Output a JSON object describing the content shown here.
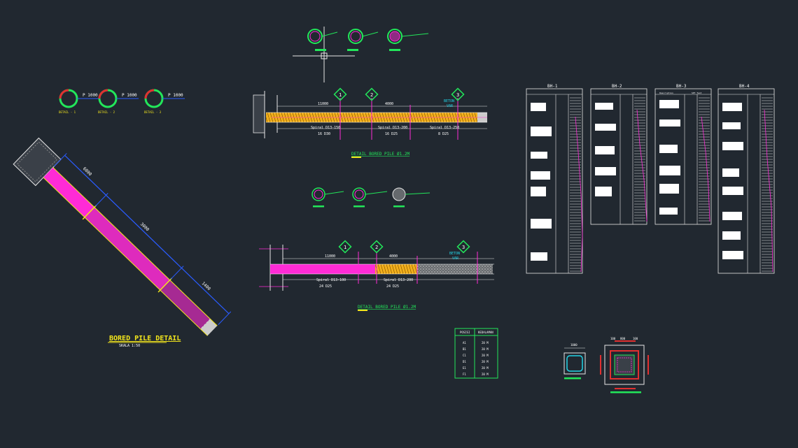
{
  "colors": {
    "background": "#212830",
    "line": "#e6e6e6",
    "dim": "#2a5cff",
    "magenta": "#ff2bd6",
    "yellow": "#f2e51c",
    "green": "#22e65a",
    "cyan": "#22d3e6",
    "red": "#e03030",
    "text_yellow": "#f2e51c",
    "log_fill": "#ffffff"
  },
  "left_detail": {
    "title": "BORED PILE DETAIL",
    "scale": "SKALA  1:50",
    "dims": [
      "6000",
      "3000",
      "1400"
    ]
  },
  "top_left_sections": [
    {
      "label": "P 1000",
      "tag": "DETAIL - 1"
    },
    {
      "label": "P 1000",
      "tag": "DETAIL - 2"
    },
    {
      "label": "P 1000",
      "tag": "DETAIL - 3"
    }
  ],
  "pile1": {
    "title": "DETAIL BORED PILE Ø1.2M",
    "markers": [
      "1",
      "2",
      "3"
    ],
    "top_dims": [
      "11000",
      "4000",
      "BETON",
      "VAR"
    ],
    "spirals": [
      "Spiral D13-150",
      "Spiral D13-200",
      "Spiral D13-250"
    ],
    "bottom_dims": [
      "16 D30",
      "16 D25",
      "8 D25"
    ]
  },
  "pile2": {
    "title": "DETAIL BORED PILE Ø1.2M",
    "markers": [
      "1",
      "2",
      "3"
    ],
    "top_dims": [
      "11000",
      "4000",
      "BETON",
      "VAR"
    ],
    "spirals": [
      "Spiral D13-100",
      "Spiral D13-200"
    ],
    "bottom_dims": [
      "24 D25",
      "24 D25"
    ]
  },
  "boreholes": {
    "titles": [
      "BH-1",
      "BH-2",
      "BH-3",
      "BH-4"
    ],
    "bh3_headers": [
      "Description",
      "SPT Test"
    ]
  },
  "table": {
    "headers": [
      "POSISI",
      "KEDALAMAN"
    ],
    "rows": [
      [
        "A1",
        "20 M"
      ],
      [
        "B1",
        "20 M"
      ],
      [
        "C1",
        "20 M"
      ],
      [
        "D1",
        "20 M"
      ],
      [
        "E1",
        "20 M"
      ],
      [
        "F1",
        "20 M"
      ]
    ]
  },
  "pile_cap": {
    "dims": [
      "1000",
      "100",
      "800",
      "100"
    ]
  }
}
